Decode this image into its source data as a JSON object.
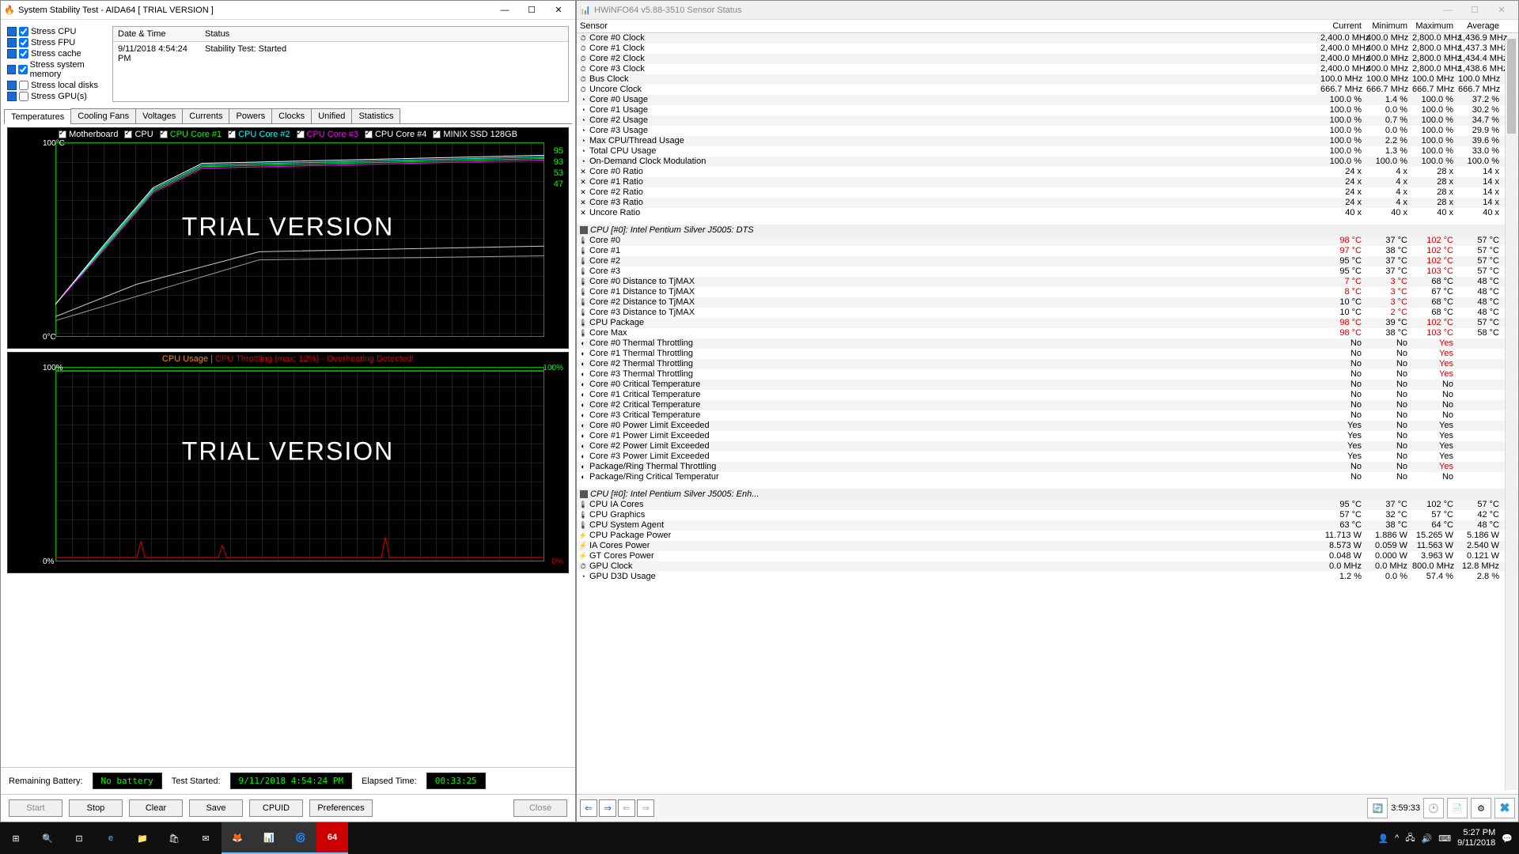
{
  "aida": {
    "title": "System Stability Test - AIDA64  [ TRIAL VERSION ]",
    "stress_options": [
      {
        "label": "Stress CPU",
        "checked": true
      },
      {
        "label": "Stress FPU",
        "checked": true
      },
      {
        "label": "Stress cache",
        "checked": true
      },
      {
        "label": "Stress system memory",
        "checked": true
      },
      {
        "label": "Stress local disks",
        "checked": false
      },
      {
        "label": "Stress GPU(s)",
        "checked": false
      }
    ],
    "log": {
      "headers": {
        "datetime": "Date & Time",
        "status": "Status"
      },
      "rows": [
        {
          "datetime": "9/11/2018 4:54:24 PM",
          "status": "Stability Test: Started"
        }
      ]
    },
    "tabs": [
      "Temperatures",
      "Cooling Fans",
      "Voltages",
      "Currents",
      "Powers",
      "Clocks",
      "Unified",
      "Statistics"
    ],
    "active_tab": "Temperatures",
    "graph1": {
      "y_top": "100°C",
      "y_bot": "0°C",
      "legend": [
        "Motherboard",
        "CPU",
        "CPU Core #1",
        "CPU Core #2",
        "CPU Core #3",
        "CPU Core #4",
        "MINIX SSD 128GB"
      ],
      "legend_colors": [
        "#fff",
        "#fff",
        "#0f0",
        "#0ff",
        "#f0f",
        "#fff",
        "#fff"
      ],
      "right_labels": [
        "95",
        "93",
        "",
        "",
        "",
        "",
        "",
        "53",
        "47"
      ],
      "watermark": "TRIAL VERSION"
    },
    "graph2": {
      "y_top": "100%",
      "y_bot": "0%",
      "right_top": "100%",
      "right_bot": "0%",
      "banner_cpu": "CPU Usage",
      "banner_sep": "  |  ",
      "banner_throttle": "CPU Throttling (max: 12%) - Overheating Detected!",
      "watermark": "TRIAL VERSION"
    },
    "status": {
      "battery_label": "Remaining Battery:",
      "battery_value": "No battery",
      "started_label": "Test Started:",
      "started_value": "9/11/2018 4:54:24 PM",
      "elapsed_label": "Elapsed Time:",
      "elapsed_value": "00:33:25"
    },
    "buttons": {
      "start": "Start",
      "stop": "Stop",
      "clear": "Clear",
      "save": "Save",
      "cpuid": "CPUID",
      "prefs": "Preferences",
      "close": "Close"
    }
  },
  "hw": {
    "title": "HWiNFO64 v5.88-3510 Sensor Status",
    "columns": {
      "sensor": "Sensor",
      "current": "Current",
      "minimum": "Minimum",
      "maximum": "Maximum",
      "average": "Average"
    },
    "group1": "",
    "rows1": [
      {
        "ic": "⏱",
        "n": "Core #0 Clock",
        "c": "2,400.0 MHz",
        "mn": "400.0 MHz",
        "mx": "2,800.0 MHz",
        "av": "1,436.9 MHz"
      },
      {
        "ic": "⏱",
        "n": "Core #1 Clock",
        "c": "2,400.0 MHz",
        "mn": "400.0 MHz",
        "mx": "2,800.0 MHz",
        "av": "1,437.3 MHz"
      },
      {
        "ic": "⏱",
        "n": "Core #2 Clock",
        "c": "2,400.0 MHz",
        "mn": "400.0 MHz",
        "mx": "2,800.0 MHz",
        "av": "1,434.4 MHz"
      },
      {
        "ic": "⏱",
        "n": "Core #3 Clock",
        "c": "2,400.0 MHz",
        "mn": "400.0 MHz",
        "mx": "2,800.0 MHz",
        "av": "1,438.6 MHz"
      },
      {
        "ic": "⏱",
        "n": "Bus Clock",
        "c": "100.0 MHz",
        "mn": "100.0 MHz",
        "mx": "100.0 MHz",
        "av": "100.0 MHz"
      },
      {
        "ic": "⏱",
        "n": "Uncore Clock",
        "c": "666.7 MHz",
        "mn": "666.7 MHz",
        "mx": "666.7 MHz",
        "av": "666.7 MHz"
      },
      {
        "ic": "◔",
        "n": "Core #0 Usage",
        "c": "100.0 %",
        "mn": "1.4 %",
        "mx": "100.0 %",
        "av": "37.2 %"
      },
      {
        "ic": "◔",
        "n": "Core #1 Usage",
        "c": "100.0 %",
        "mn": "0.0 %",
        "mx": "100.0 %",
        "av": "30.2 %"
      },
      {
        "ic": "◔",
        "n": "Core #2 Usage",
        "c": "100.0 %",
        "mn": "0.7 %",
        "mx": "100.0 %",
        "av": "34.7 %"
      },
      {
        "ic": "◔",
        "n": "Core #3 Usage",
        "c": "100.0 %",
        "mn": "0.0 %",
        "mx": "100.0 %",
        "av": "29.9 %"
      },
      {
        "ic": "◔",
        "n": "Max CPU/Thread Usage",
        "c": "100.0 %",
        "mn": "2.2 %",
        "mx": "100.0 %",
        "av": "39.6 %"
      },
      {
        "ic": "◔",
        "n": "Total CPU Usage",
        "c": "100.0 %",
        "mn": "1.3 %",
        "mx": "100.0 %",
        "av": "33.0 %"
      },
      {
        "ic": "◔",
        "n": "On-Demand Clock Modulation",
        "c": "100.0 %",
        "mn": "100.0 %",
        "mx": "100.0 %",
        "av": "100.0 %"
      },
      {
        "ic": "✕",
        "n": "Core #0 Ratio",
        "c": "24 x",
        "mn": "4 x",
        "mx": "28 x",
        "av": "14 x"
      },
      {
        "ic": "✕",
        "n": "Core #1 Ratio",
        "c": "24 x",
        "mn": "4 x",
        "mx": "28 x",
        "av": "14 x"
      },
      {
        "ic": "✕",
        "n": "Core #2 Ratio",
        "c": "24 x",
        "mn": "4 x",
        "mx": "28 x",
        "av": "14 x"
      },
      {
        "ic": "✕",
        "n": "Core #3 Ratio",
        "c": "24 x",
        "mn": "4 x",
        "mx": "28 x",
        "av": "14 x"
      },
      {
        "ic": "✕",
        "n": "Uncore Ratio",
        "c": "40 x",
        "mn": "40 x",
        "mx": "40 x",
        "av": "40 x"
      }
    ],
    "group2": "CPU [#0]: Intel Pentium Silver J5005: DTS",
    "rows2": [
      {
        "ic": "🌡",
        "n": "Core #0",
        "c": "98 °C",
        "mn": "37 °C",
        "mx": "102 °C",
        "av": "57 °C",
        "cr": 1,
        "mr": 1
      },
      {
        "ic": "🌡",
        "n": "Core #1",
        "c": "97 °C",
        "mn": "38 °C",
        "mx": "102 °C",
        "av": "57 °C",
        "cr": 1,
        "mr": 1
      },
      {
        "ic": "🌡",
        "n": "Core #2",
        "c": "95 °C",
        "mn": "37 °C",
        "mx": "102 °C",
        "av": "57 °C",
        "mr": 1
      },
      {
        "ic": "🌡",
        "n": "Core #3",
        "c": "95 °C",
        "mn": "37 °C",
        "mx": "103 °C",
        "av": "57 °C",
        "mr": 1
      },
      {
        "ic": "🌡",
        "n": "Core #0 Distance to TjMAX",
        "c": "7 °C",
        "mn": "3 °C",
        "mx": "68 °C",
        "av": "48 °C",
        "cr": 1,
        "mnr": 1
      },
      {
        "ic": "🌡",
        "n": "Core #1 Distance to TjMAX",
        "c": "8 °C",
        "mn": "3 °C",
        "mx": "67 °C",
        "av": "48 °C",
        "cr": 1,
        "mnr": 1
      },
      {
        "ic": "🌡",
        "n": "Core #2 Distance to TjMAX",
        "c": "10 °C",
        "mn": "3 °C",
        "mx": "68 °C",
        "av": "48 °C",
        "mnr": 1
      },
      {
        "ic": "🌡",
        "n": "Core #3 Distance to TjMAX",
        "c": "10 °C",
        "mn": "2 °C",
        "mx": "68 °C",
        "av": "48 °C",
        "mnr": 1
      },
      {
        "ic": "🌡",
        "n": "CPU Package",
        "c": "98 °C",
        "mn": "39 °C",
        "mx": "102 °C",
        "av": "57 °C",
        "cr": 1,
        "mr": 1
      },
      {
        "ic": "🌡",
        "n": "Core Max",
        "c": "98 °C",
        "mn": "38 °C",
        "mx": "103 °C",
        "av": "58 °C",
        "cr": 1,
        "mr": 1
      },
      {
        "ic": "◐",
        "n": "Core #0 Thermal Throttling",
        "c": "No",
        "mn": "No",
        "mx": "Yes",
        "av": "",
        "mr": 1
      },
      {
        "ic": "◐",
        "n": "Core #1 Thermal Throttling",
        "c": "No",
        "mn": "No",
        "mx": "Yes",
        "av": "",
        "mr": 1
      },
      {
        "ic": "◐",
        "n": "Core #2 Thermal Throttling",
        "c": "No",
        "mn": "No",
        "mx": "Yes",
        "av": "",
        "mr": 1
      },
      {
        "ic": "◐",
        "n": "Core #3 Thermal Throttling",
        "c": "No",
        "mn": "No",
        "mx": "Yes",
        "av": "",
        "mr": 1
      },
      {
        "ic": "◐",
        "n": "Core #0 Critical Temperature",
        "c": "No",
        "mn": "No",
        "mx": "No",
        "av": ""
      },
      {
        "ic": "◐",
        "n": "Core #1 Critical Temperature",
        "c": "No",
        "mn": "No",
        "mx": "No",
        "av": ""
      },
      {
        "ic": "◐",
        "n": "Core #2 Critical Temperature",
        "c": "No",
        "mn": "No",
        "mx": "No",
        "av": ""
      },
      {
        "ic": "◐",
        "n": "Core #3 Critical Temperature",
        "c": "No",
        "mn": "No",
        "mx": "No",
        "av": ""
      },
      {
        "ic": "◐",
        "n": "Core #0 Power Limit Exceeded",
        "c": "Yes",
        "mn": "No",
        "mx": "Yes",
        "av": ""
      },
      {
        "ic": "◐",
        "n": "Core #1 Power Limit Exceeded",
        "c": "Yes",
        "mn": "No",
        "mx": "Yes",
        "av": ""
      },
      {
        "ic": "◐",
        "n": "Core #2 Power Limit Exceeded",
        "c": "Yes",
        "mn": "No",
        "mx": "Yes",
        "av": ""
      },
      {
        "ic": "◐",
        "n": "Core #3 Power Limit Exceeded",
        "c": "Yes",
        "mn": "No",
        "mx": "Yes",
        "av": ""
      },
      {
        "ic": "◐",
        "n": "Package/Ring Thermal Throttling",
        "c": "No",
        "mn": "No",
        "mx": "Yes",
        "av": "",
        "mr": 1
      },
      {
        "ic": "◐",
        "n": "Package/Ring Critical Temperature",
        "c": "No",
        "mn": "No",
        "mx": "No",
        "av": ""
      }
    ],
    "group3": "CPU [#0]: Intel Pentium Silver J5005: Enh...",
    "rows3": [
      {
        "ic": "🌡",
        "n": "CPU IA Cores",
        "c": "95 °C",
        "mn": "37 °C",
        "mx": "102 °C",
        "av": "57 °C"
      },
      {
        "ic": "🌡",
        "n": "CPU Graphics",
        "c": "57 °C",
        "mn": "32 °C",
        "mx": "57 °C",
        "av": "42 °C"
      },
      {
        "ic": "🌡",
        "n": "CPU System Agent",
        "c": "63 °C",
        "mn": "38 °C",
        "mx": "64 °C",
        "av": "48 °C"
      },
      {
        "ic": "⚡",
        "n": "CPU Package Power",
        "c": "11.713 W",
        "mn": "1.886 W",
        "mx": "15.265 W",
        "av": "5.186 W"
      },
      {
        "ic": "⚡",
        "n": "IA Cores Power",
        "c": "8.573 W",
        "mn": "0.059 W",
        "mx": "11.563 W",
        "av": "2.540 W"
      },
      {
        "ic": "⚡",
        "n": "GT Cores Power",
        "c": "0.048 W",
        "mn": "0.000 W",
        "mx": "3.963 W",
        "av": "0.121 W"
      },
      {
        "ic": "⏱",
        "n": "GPU Clock",
        "c": "0.0 MHz",
        "mn": "0.0 MHz",
        "mx": "800.0 MHz",
        "av": "12.8 MHz"
      },
      {
        "ic": "◔",
        "n": "GPU D3D Usage",
        "c": "1.2 %",
        "mn": "0.0 %",
        "mx": "57.4 %",
        "av": "2.8 %"
      }
    ],
    "toolbar_time": "3:59:33"
  },
  "taskbar": {
    "time": "5:27 PM",
    "date": "9/11/2018"
  },
  "chart_data": [
    {
      "type": "line",
      "title": "Temperatures",
      "ylabel": "°C",
      "ylim": [
        0,
        100
      ],
      "series_names": [
        "Motherboard",
        "CPU",
        "CPU Core #1",
        "CPU Core #2",
        "CPU Core #3",
        "CPU Core #4",
        "MINIX SSD 128GB"
      ],
      "current_values": [
        53,
        95,
        95,
        95,
        93,
        95,
        47
      ],
      "note": "CPU curves rise from ~40°C to ~95°C with heavy jitter near top; Motherboard plateaus ~53°C; SSD plateaus ~47°C"
    },
    {
      "type": "line",
      "title": "CPU Usage / Throttling",
      "ylabel": "%",
      "ylim": [
        0,
        100
      ],
      "series_names": [
        "CPU Usage",
        "CPU Throttling"
      ],
      "current_values": [
        100,
        0
      ],
      "max_throttling": 12,
      "note": "CPU Usage flat at 100% across test; Throttling mostly 0% with intermittent spikes, max 12%"
    }
  ]
}
